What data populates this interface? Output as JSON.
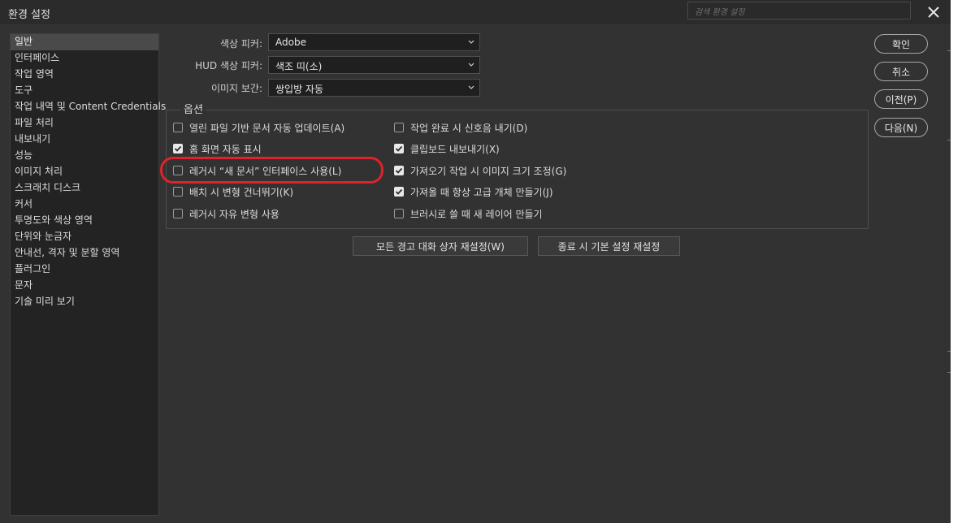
{
  "window": {
    "title": "환경 설정"
  },
  "search": {
    "placeholder": "검색 환경 설정"
  },
  "icons": {
    "close": "close-icon",
    "caret": "chevron-down-icon",
    "check": "checkmark-icon"
  },
  "colors": {
    "highlight": "#e0222a",
    "background": "#323232",
    "sidebar": "#232323",
    "selected": "#4a4a4a"
  },
  "sidebar": {
    "items": [
      {
        "label": "일반",
        "selected": true
      },
      {
        "label": "인터페이스"
      },
      {
        "label": "작업 영역"
      },
      {
        "label": "도구"
      },
      {
        "label": "작업 내역 및 Content Credentials"
      },
      {
        "label": "파일 처리"
      },
      {
        "label": "내보내기"
      },
      {
        "label": "성능"
      },
      {
        "label": "이미지 처리"
      },
      {
        "label": "스크래치 디스크"
      },
      {
        "label": "커서"
      },
      {
        "label": "투명도와 색상 영역"
      },
      {
        "label": "단위와 눈금자"
      },
      {
        "label": "안내선, 격자 및 분할 영역"
      },
      {
        "label": "플러그인"
      },
      {
        "label": "문자"
      },
      {
        "label": "기술 미리 보기"
      }
    ]
  },
  "fields": {
    "color_picker": {
      "label": "색상 피커:",
      "value": "Adobe"
    },
    "hud_picker": {
      "label": "HUD 색상 피커:",
      "value": "색조 띠(소)"
    },
    "interpolation": {
      "label": "이미지 보간:",
      "value": "쌍입방 자동"
    }
  },
  "options": {
    "legend": "옵션",
    "left": [
      {
        "label": "열린 파일 기반 문서 자동 업데이트(A)",
        "checked": false
      },
      {
        "label": "홈 화면 자동 표시",
        "checked": true
      },
      {
        "label": "레거시 “새 문서” 인터페이스 사용(L)",
        "checked": false
      },
      {
        "label": "배치 시 변형 건너뛰기(K)",
        "checked": false
      },
      {
        "label": "레거시 자유 변형 사용",
        "checked": false
      }
    ],
    "right": [
      {
        "label": "작업 완료 시 신호음 내기(D)",
        "checked": false
      },
      {
        "label": "클립보드 내보내기(X)",
        "checked": true
      },
      {
        "label": "가져오기 작업 시 이미지 크기 조정(G)",
        "checked": true
      },
      {
        "label": "가져올 때 항상 고급 개체 만들기(J)",
        "checked": true
      },
      {
        "label": "브러시로 쓸 때 새 레이어 만들기",
        "checked": false
      }
    ]
  },
  "buttons": {
    "reset_warnings": "모든 경고 대화 상자 재설정(W)",
    "reset_on_quit": "종료 시 기본 설정 재설정",
    "ok": "확인",
    "cancel": "취소",
    "prev": "이전(P)",
    "next": "다음(N)"
  }
}
